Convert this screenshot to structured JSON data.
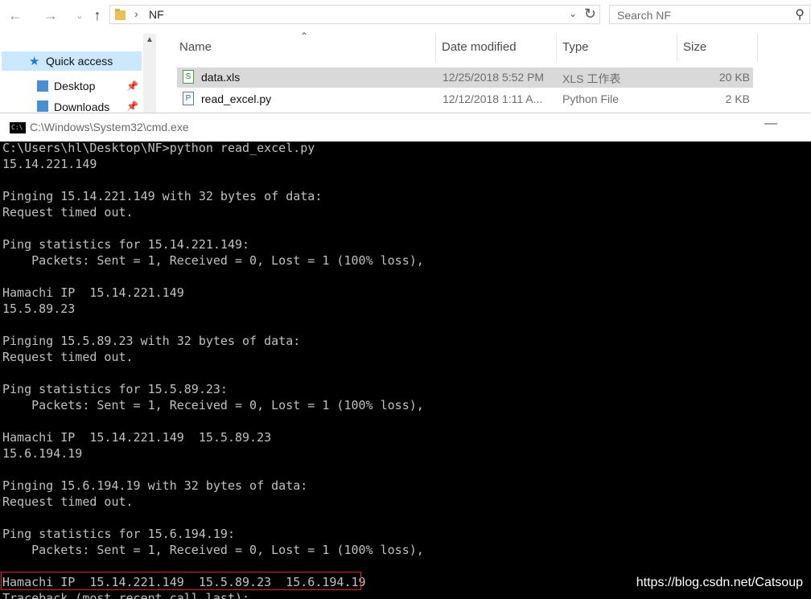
{
  "explorer": {
    "address_path": "NF",
    "search_placeholder": "Search NF",
    "nav": {
      "quick_access": "Quick access",
      "desktop": "Desktop",
      "downloads": "Downloads"
    },
    "columns": {
      "name": "Name",
      "date": "Date modified",
      "type": "Type",
      "size": "Size"
    },
    "files": [
      {
        "name": "data.xls",
        "date": "12/25/2018 5:52 PM",
        "type": "XLS 工作表",
        "size": "20 KB"
      },
      {
        "name": "read_excel.py",
        "date": "12/12/2018 1:11 A...",
        "type": "Python File",
        "size": "2 KB"
      }
    ]
  },
  "cmd": {
    "title": "C:\\Windows\\System32\\cmd.exe",
    "lines": [
      "C:\\Users\\hl\\Desktop\\NF>python read_excel.py",
      "15.14.221.149",
      "",
      "Pinging 15.14.221.149 with 32 bytes of data:",
      "Request timed out.",
      "",
      "Ping statistics for 15.14.221.149:",
      "    Packets: Sent = 1, Received = 0, Lost = 1 (100% loss),",
      "",
      "Hamachi IP  15.14.221.149",
      "15.5.89.23",
      "",
      "Pinging 15.5.89.23 with 32 bytes of data:",
      "Request timed out.",
      "",
      "Ping statistics for 15.5.89.23:",
      "    Packets: Sent = 1, Received = 0, Lost = 1 (100% loss),",
      "",
      "Hamachi IP  15.14.221.149  15.5.89.23",
      "15.6.194.19",
      "",
      "Pinging 15.6.194.19 with 32 bytes of data:",
      "Request timed out.",
      "",
      "Ping statistics for 15.6.194.19:",
      "    Packets: Sent = 1, Received = 0, Lost = 1 (100% loss),",
      "",
      "Hamachi IP  15.14.221.149  15.5.89.23  15.6.194.19",
      "Traceback (most recent call last):"
    ],
    "watermark": "https://blog.csdn.net/Catsoup",
    "highlight_color": "#e0222c"
  }
}
